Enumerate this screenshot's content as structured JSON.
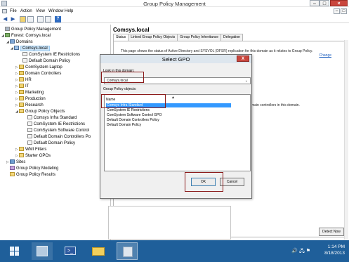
{
  "window": {
    "title": "Group Policy Management",
    "controls": {
      "minimize": "–",
      "maximize": "□",
      "close": "×"
    }
  },
  "menu": {
    "items": [
      "File",
      "Action",
      "View",
      "Window",
      "Help"
    ],
    "mdi_controls": [
      "–",
      "□"
    ]
  },
  "toolbar": {
    "icons": [
      "back-arrow-icon",
      "forward-arrow-icon",
      "up-folder-icon",
      "show-hide-tree-icon",
      "refresh-icon",
      "export-icon",
      "help-icon"
    ],
    "back_glyph": "◀",
    "forward_glyph": "▶",
    "help_glyph": "?"
  },
  "tree": {
    "items": [
      {
        "label": "Group Policy Management",
        "expander": "",
        "icon": "gpm-icon"
      },
      {
        "label": "Forest: Comsys.local",
        "expander": "◢",
        "icon": "forest-icon"
      },
      {
        "label": "Domains",
        "expander": "◢",
        "icon": "domains-icon"
      },
      {
        "label": "Comsys.local",
        "expander": "◢",
        "icon": "domain-icon"
      },
      {
        "label": "ComSystem IE Restrictions",
        "expander": "",
        "icon": "gpo-link-icon"
      },
      {
        "label": "Default Domain Policy",
        "expander": "",
        "icon": "gpo-link-icon"
      },
      {
        "label": "ComSystem Laptop",
        "expander": "▷",
        "icon": "ou-icon"
      },
      {
        "label": "Domain Controllers",
        "expander": "▷",
        "icon": "ou-icon"
      },
      {
        "label": "HR",
        "expander": "▷",
        "icon": "ou-icon"
      },
      {
        "label": "IT",
        "expander": "▷",
        "icon": "ou-icon"
      },
      {
        "label": "Marketing",
        "expander": "▷",
        "icon": "ou-icon"
      },
      {
        "label": "Production",
        "expander": "▷",
        "icon": "ou-icon"
      },
      {
        "label": "Research",
        "expander": "▷",
        "icon": "ou-icon"
      },
      {
        "label": "Group Policy Objects",
        "expander": "◢",
        "icon": "folder-icon"
      },
      {
        "label": "Comsys Infra Standard",
        "expander": "",
        "icon": "gpo-icon"
      },
      {
        "label": "ComSystem IE Restrictions",
        "expander": "",
        "icon": "gpo-icon"
      },
      {
        "label": "ComSystem Software Control",
        "expander": "",
        "icon": "gpo-icon"
      },
      {
        "label": "Default Domain Controllers Po",
        "expander": "",
        "icon": "gpo-icon"
      },
      {
        "label": "Default Domain Policy",
        "expander": "",
        "icon": "gpo-icon"
      },
      {
        "label": "WMI Filters",
        "expander": "▷",
        "icon": "folder-icon"
      },
      {
        "label": "Starter GPOs",
        "expander": "▷",
        "icon": "folder-icon"
      },
      {
        "label": "Sites",
        "expander": "▷",
        "icon": "sites-icon"
      },
      {
        "label": "Group Policy Modeling",
        "expander": "",
        "icon": "modeling-icon"
      },
      {
        "label": "Group Policy Results",
        "expander": "",
        "icon": "results-icon"
      }
    ],
    "selected_index": 3
  },
  "right_pane": {
    "heading": "Comsys.local",
    "tabs": [
      "Status",
      "Linked Group Policy Objects",
      "Group Policy Inheritance",
      "Delegation"
    ],
    "active_tab": 0,
    "status_text": "This page shows the status of Active Directory and SYSVOL (DFSR) replication for this domain as it relates to Group Policy.",
    "change_link": "Change",
    "dc_text": "main controllers in this domain.",
    "detect_button": "Detect Now"
  },
  "dialog": {
    "title": "Select GPO",
    "close": "X",
    "look_in_label": "Look in this domain:",
    "domain_value": "Comsys.local",
    "chevron": "⌄",
    "objects_label": "Group Policy objects:",
    "column_header": "Name",
    "sort_glyph": "▲",
    "gpos": [
      "Comsys Infra Standard",
      "ComSystem IE Restrictions",
      "ComSystem Software Control GPO",
      "Default Domain Controllers Policy",
      "Default Domain Policy"
    ],
    "selected_index": 0,
    "ok_label": "OK",
    "cancel_label": "Cancel"
  },
  "taskbar": {
    "clock_time": "1:14 PM",
    "clock_date": "8/18/2013",
    "ps_glyph": ">_",
    "tray_icons": "🔊 🖧 ⚑"
  },
  "colors": {
    "highlight": "#8b1a1a",
    "selection": "#3399ff",
    "taskbar": "#1f5f9a"
  }
}
